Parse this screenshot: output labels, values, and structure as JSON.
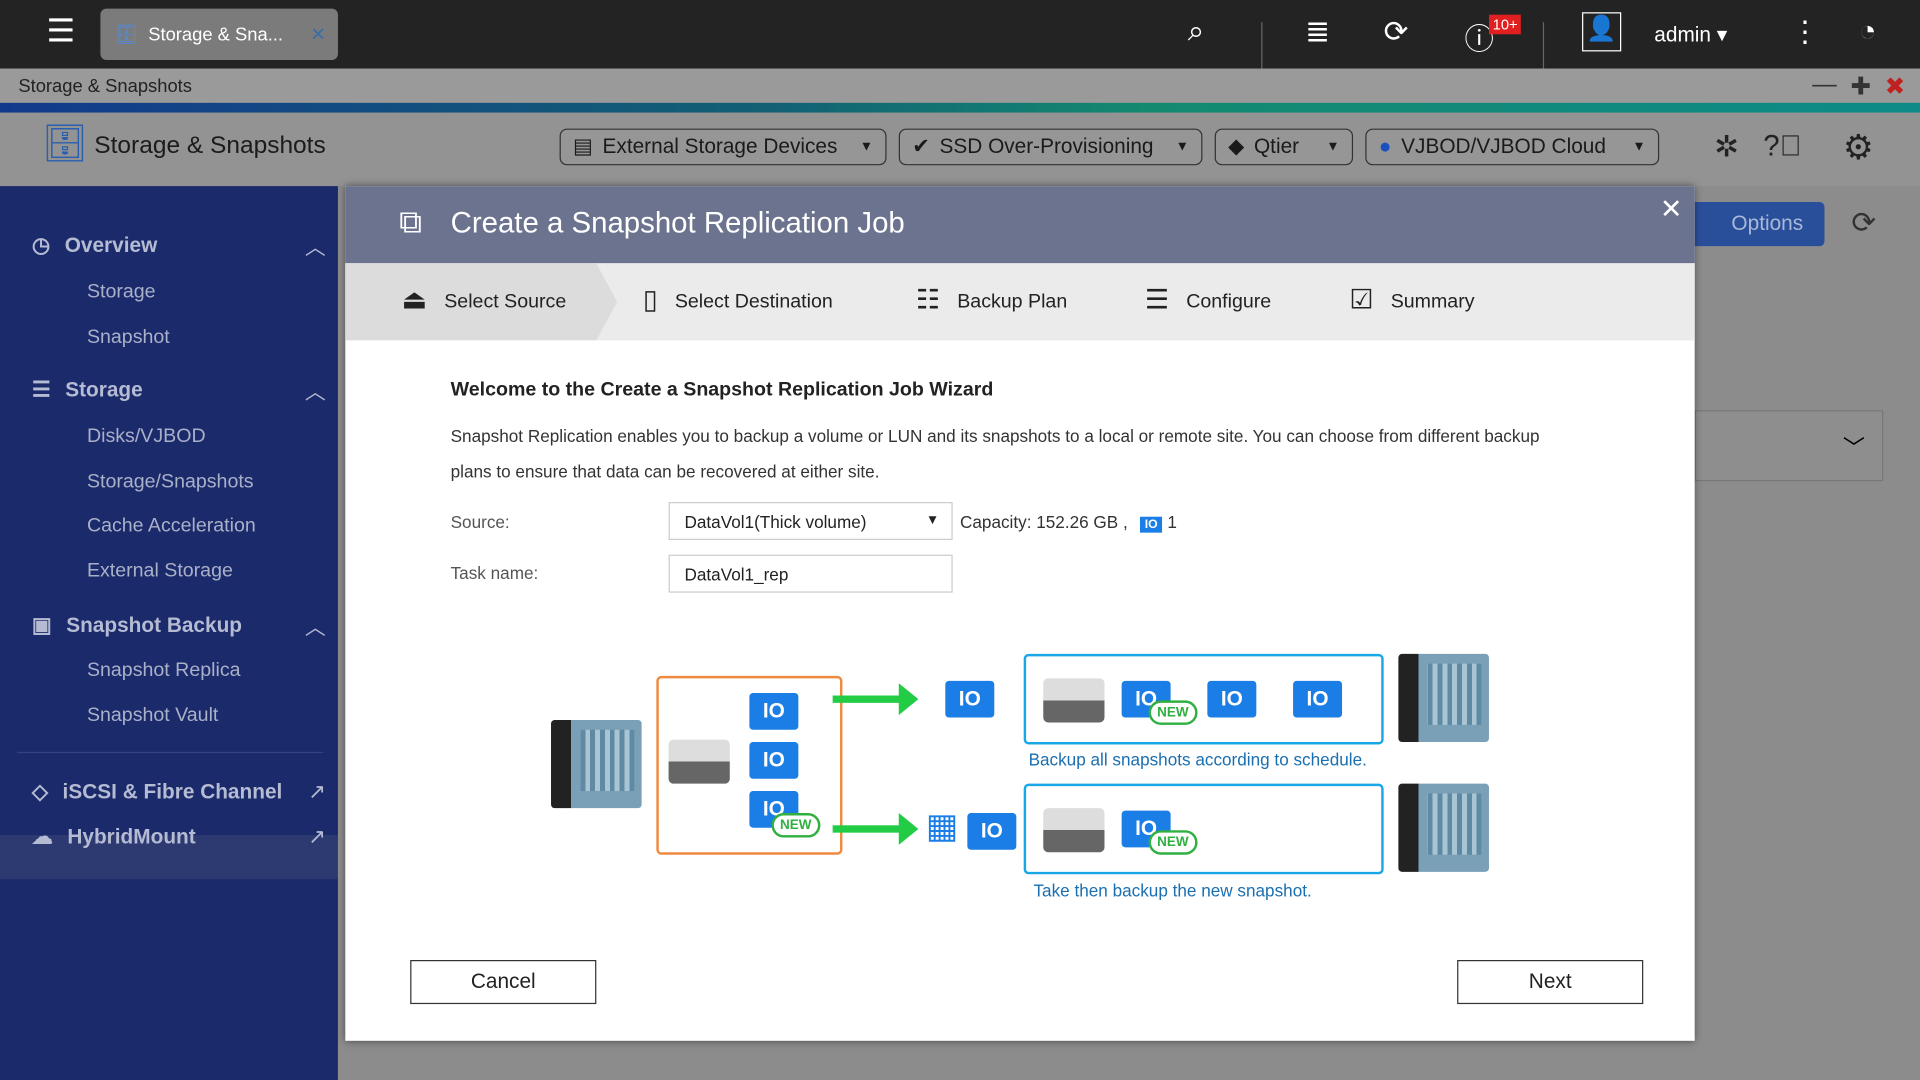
{
  "topbar": {
    "tab_label": "Storage & Sna...",
    "notification_badge": "10+",
    "user": "admin"
  },
  "window": {
    "title": "Storage & Snapshots"
  },
  "app": {
    "name": "Storage & Snapshots",
    "buttons": [
      "External Storage Devices",
      "SSD Over-Provisioning",
      "Qtier",
      "VJBOD/VJBOD Cloud"
    ],
    "options_label": "Options"
  },
  "sidebar": {
    "sections": [
      {
        "label": "Overview",
        "items": [
          "Storage",
          "Snapshot"
        ]
      },
      {
        "label": "Storage",
        "items": [
          "Disks/VJBOD",
          "Storage/Snapshots",
          "Cache Acceleration",
          "External Storage"
        ]
      },
      {
        "label": "Snapshot Backup",
        "items": [
          "Snapshot Replica",
          "Snapshot Vault"
        ]
      }
    ],
    "links": [
      "iSCSI & Fibre Channel",
      "HybridMount"
    ],
    "selected": "Snapshot Replica"
  },
  "modal": {
    "title": "Create a Snapshot Replication Job",
    "steps": [
      "Select Source",
      "Select Destination",
      "Backup Plan",
      "Configure",
      "Summary"
    ],
    "active_step": "Select Source",
    "heading": "Welcome to the Create a Snapshot Replication Job Wizard",
    "description": "Snapshot Replication enables you to backup a volume or LUN and its snapshots to a local or remote site. You can choose from different backup plans to ensure that data can be recovered at either site.",
    "source_label": "Source:",
    "source_value": "DataVol1(Thick volume)",
    "capacity": "Capacity: 152.26 GB ,",
    "snapshot_count": "1",
    "task_label": "Task name:",
    "task_value": "DataVol1_rep",
    "diagram": {
      "new_label": "NEW",
      "snap_glyph": "IO",
      "caption1": "Backup all snapshots according to schedule.",
      "caption2": "Take then backup the new snapshot."
    },
    "cancel": "Cancel",
    "next": "Next"
  }
}
